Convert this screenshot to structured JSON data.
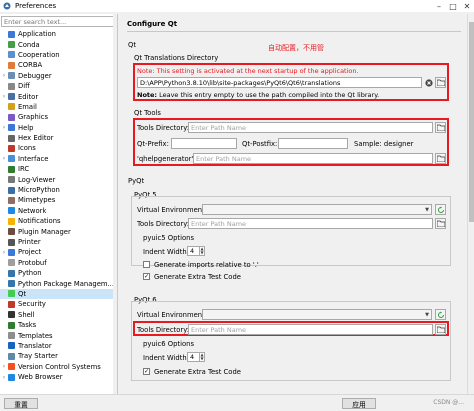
{
  "window": {
    "title": "Preferences"
  },
  "search": {
    "placeholder": "Enter search text..."
  },
  "sidebar": {
    "items": [
      {
        "label": "Application",
        "expandable": false,
        "color": "#3c78d8"
      },
      {
        "label": "Conda",
        "expandable": false,
        "color": "#43a047"
      },
      {
        "label": "Cooperation",
        "expandable": false,
        "color": "#5a8fd0"
      },
      {
        "label": "CORBA",
        "expandable": false,
        "color": "#e07b39"
      },
      {
        "label": "Debugger",
        "expandable": true,
        "color": "#6a8fb5"
      },
      {
        "label": "Diff",
        "expandable": false,
        "color": "#888888"
      },
      {
        "label": "Editor",
        "expandable": true,
        "color": "#4a6fa5"
      },
      {
        "label": "Email",
        "expandable": false,
        "color": "#d4a017"
      },
      {
        "label": "Graphics",
        "expandable": false,
        "color": "#7a5bc4"
      },
      {
        "label": "Help",
        "expandable": true,
        "color": "#3c78d8"
      },
      {
        "label": "Hex Editor",
        "expandable": false,
        "color": "#666666"
      },
      {
        "label": "Icons",
        "expandable": false,
        "color": "#c0392b"
      },
      {
        "label": "Interface",
        "expandable": true,
        "color": "#4a90d9"
      },
      {
        "label": "IRC",
        "expandable": false,
        "color": "#2e7d32"
      },
      {
        "label": "Log-Viewer",
        "expandable": false,
        "color": "#777777"
      },
      {
        "label": "MicroPython",
        "expandable": false,
        "color": "#3b6ea5"
      },
      {
        "label": "Mimetypes",
        "expandable": false,
        "color": "#8d6e63"
      },
      {
        "label": "Network",
        "expandable": false,
        "color": "#1e88e5"
      },
      {
        "label": "Notifications",
        "expandable": false,
        "color": "#f4b400"
      },
      {
        "label": "Plugin Manager",
        "expandable": false,
        "color": "#6d4c41"
      },
      {
        "label": "Printer",
        "expandable": false,
        "color": "#555555"
      },
      {
        "label": "Project",
        "expandable": true,
        "color": "#3c78d8"
      },
      {
        "label": "Protobuf",
        "expandable": false,
        "color": "#9e9e9e"
      },
      {
        "label": "Python",
        "expandable": false,
        "color": "#3776ab"
      },
      {
        "label": "Python Package Managem...",
        "expandable": false,
        "color": "#3776ab"
      },
      {
        "label": "Qt",
        "expandable": false,
        "color": "#41cd52",
        "selected": true
      },
      {
        "label": "Security",
        "expandable": false,
        "color": "#c0392b"
      },
      {
        "label": "Shell",
        "expandable": false,
        "color": "#333333"
      },
      {
        "label": "Tasks",
        "expandable": false,
        "color": "#2e7d32"
      },
      {
        "label": "Templates",
        "expandable": false,
        "color": "#8e8e8e"
      },
      {
        "label": "Translator",
        "expandable": false,
        "color": "#1565c0"
      },
      {
        "label": "Tray Starter",
        "expandable": false,
        "color": "#5d8aa8"
      },
      {
        "label": "Version Control Systems",
        "expandable": true,
        "color": "#f4511e"
      },
      {
        "label": "Web Browser",
        "expandable": true,
        "color": "#1e88e5"
      }
    ]
  },
  "main": {
    "title": "Configure Qt",
    "qt_group": "Qt",
    "translations_dir_label": "Qt Translations Directory",
    "annotation": "自动配置，不用管",
    "activation_note": "Note: This setting is activated at the next startup of the application.",
    "translations_path": "D:\\APP\\Python3.8.10\\lib\\site-packages\\PyQt6\\Qt6\\translations",
    "empty_note_bold": "Note:",
    "empty_note_text": " Leave this entry empty to use the path compiled into the Qt library.",
    "qt_tools_label": "Qt Tools",
    "tools_directory_label": "Tools Directory:",
    "tools_directory_placeholder": "Enter Path Name",
    "qt_prefix_label": "Qt-Prefix:",
    "qt_postfix_label": "Qt-Postfix:",
    "sample_text": "Sample: designer",
    "qhelpgenerator_label": "'qhelpgenerator':",
    "qhelpgenerator_placeholder": "Enter Path Name",
    "pyqt_label": "PyQt",
    "pyqt5_label": "PyQt 5",
    "pyqt5_venv_label": "Virtual Environment:",
    "pyqt5_tools_label": "Tools Directory:",
    "pyqt5_tools_placeholder": "Enter Path Name",
    "pyuic5_label": "pyuic5 Options",
    "pyuic5_indent_label": "Indent Width:",
    "pyuic5_indent_value": "4",
    "pyuic5_imports_label": "Generate imports relative to '.'",
    "pyuic5_imports_checked": false,
    "pyuic5_extra_label": "Generate Extra Test Code",
    "pyuic5_extra_checked": true,
    "pyqt6_label": "PyQt 6",
    "pyqt6_venv_label": "Virtual Environment:",
    "pyqt6_tools_label": "Tools Directory:",
    "pyqt6_tools_placeholder": "Enter Path Name",
    "pyuic6_label": "pyuic6 Options",
    "pyuic6_indent_label": "Indent Width:",
    "pyuic6_indent_value": "4",
    "pyuic6_extra_label": "Generate Extra Test Code",
    "pyuic6_extra_checked": true
  },
  "footer": {
    "reset_label": "重置",
    "apply_label": "应用",
    "watermark": "CSDN @..."
  },
  "colors": {
    "annotation_red": "#e8191f",
    "selection": "#cce4f7"
  }
}
